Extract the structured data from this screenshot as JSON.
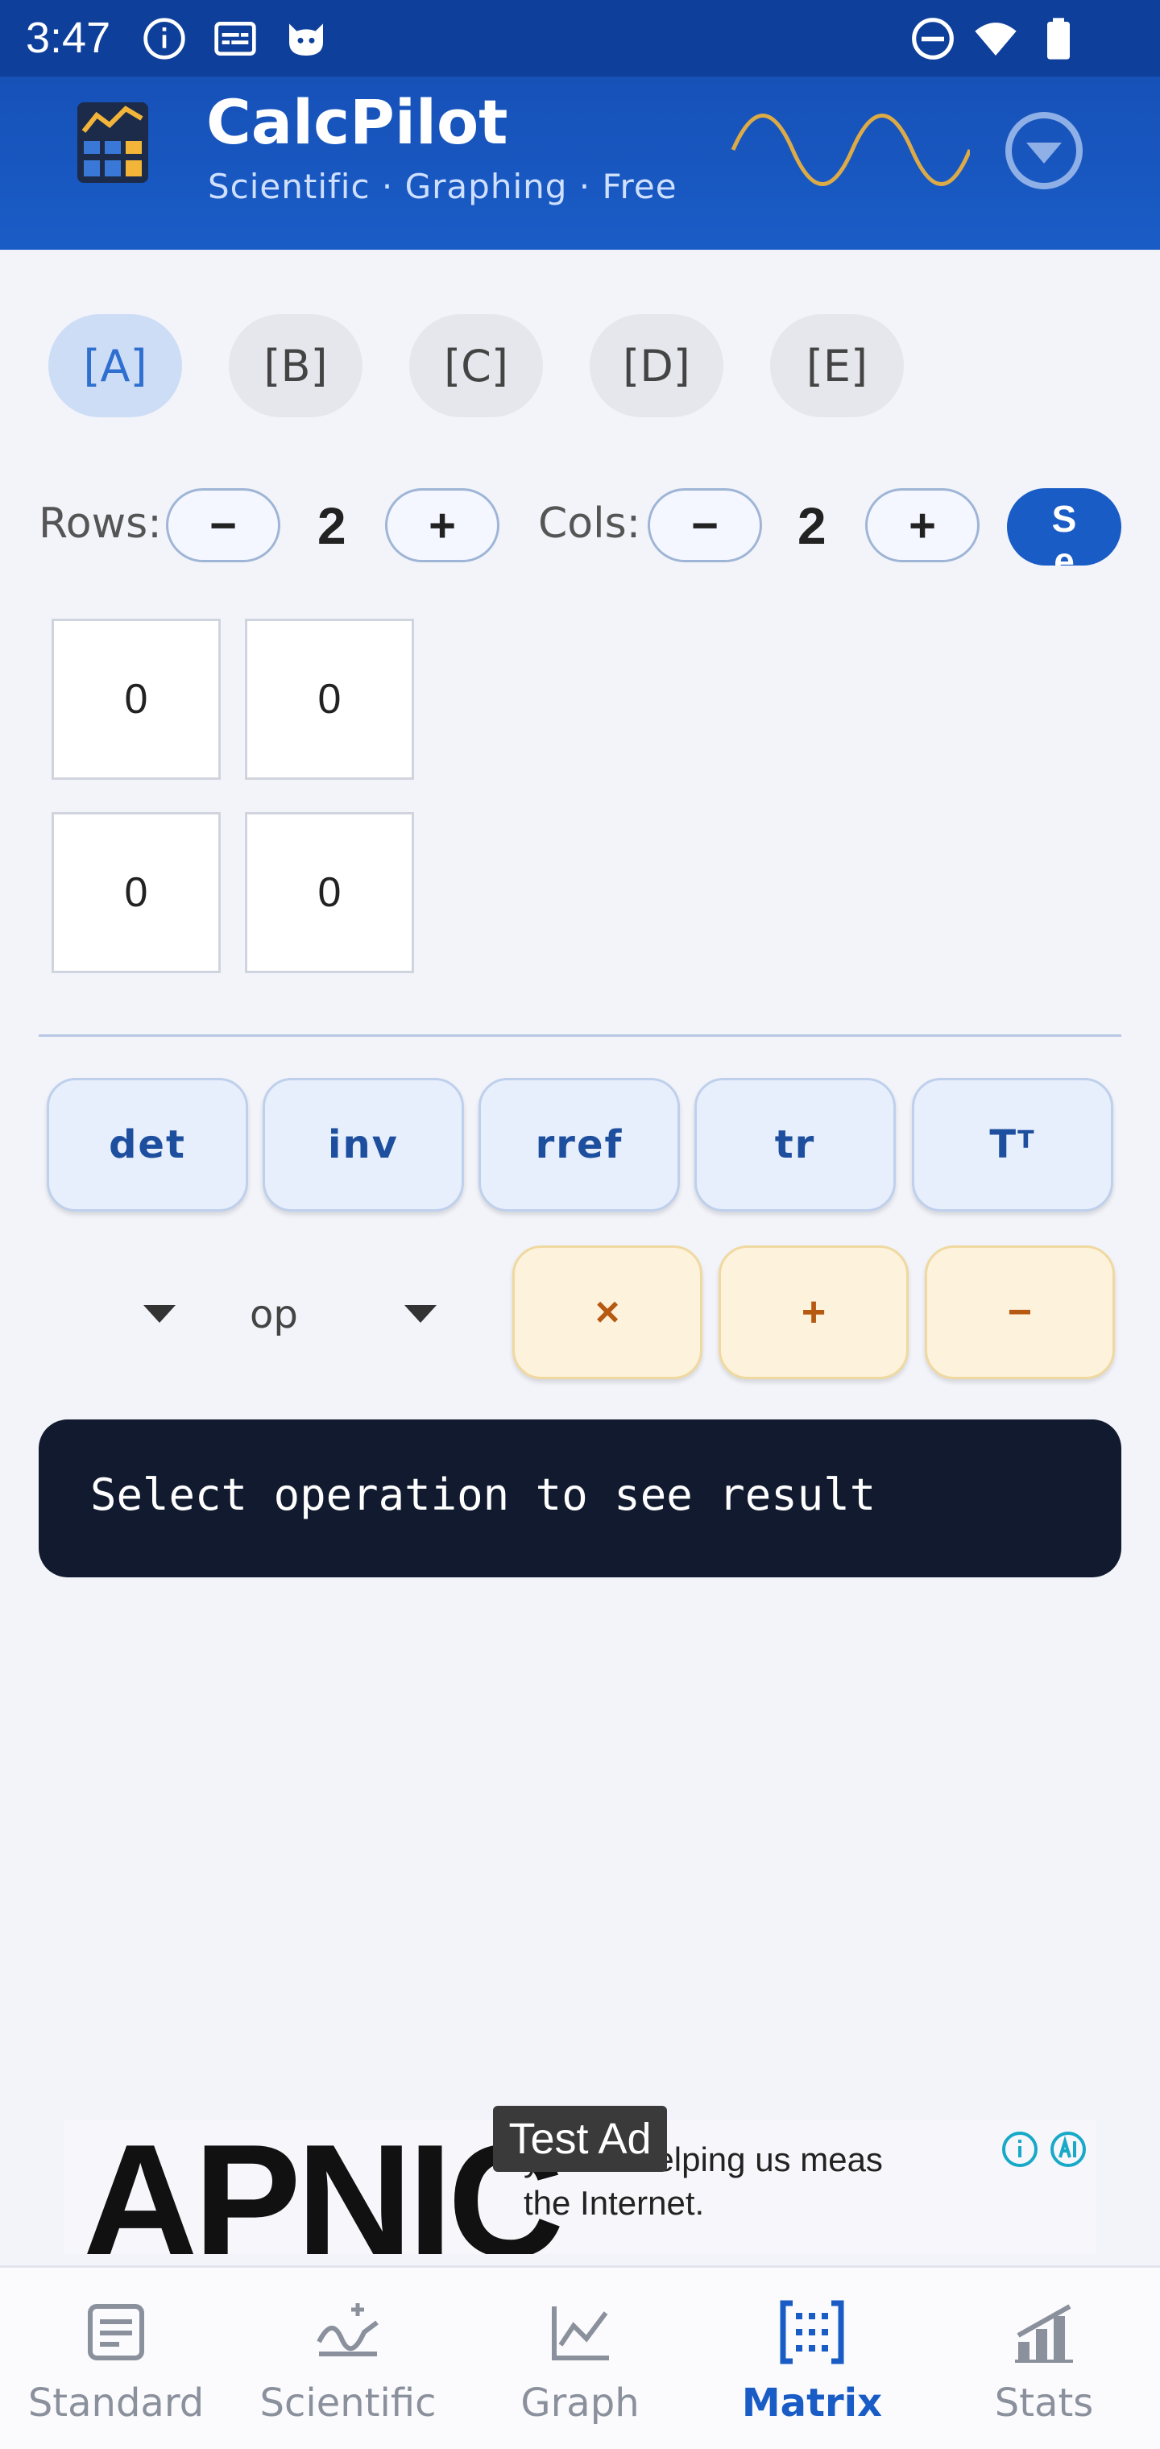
{
  "status_bar": {
    "time": "3:47",
    "left_icons": [
      "info-icon",
      "subtitles-icon",
      "cat-face-icon"
    ],
    "right_icons": [
      "do-not-disturb-icon",
      "wifi-icon",
      "battery-icon"
    ]
  },
  "header": {
    "title": "CalcPilot",
    "subtitle": "Scientific · Graphing · Free",
    "accent": "#1a5cc6",
    "wave_color": "#f2b53a"
  },
  "matrix_tabs": [
    {
      "label": "[A]",
      "active": true
    },
    {
      "label": "[B]",
      "active": false
    },
    {
      "label": "[C]",
      "active": false
    },
    {
      "label": "[D]",
      "active": false
    },
    {
      "label": "[E]",
      "active": false
    }
  ],
  "dimensions": {
    "rows_label": "Rows:",
    "rows_value": "2",
    "cols_label": "Cols:",
    "cols_value": "2",
    "minus_label": "−",
    "plus_label": "+",
    "save_label": "S\ne"
  },
  "matrix_values": [
    [
      "0",
      "0"
    ],
    [
      "0",
      "0"
    ]
  ],
  "unary_ops": [
    {
      "label": "det"
    },
    {
      "label": "inv"
    },
    {
      "label": "rref"
    },
    {
      "label": "tr"
    },
    {
      "label": "T",
      "sup": "T"
    }
  ],
  "binary": {
    "op_label": "op",
    "ops": [
      "×",
      "+",
      "−"
    ]
  },
  "result": {
    "text": "Select operation to see result"
  },
  "ad": {
    "badge": "Test Ad",
    "logo": "APNIC",
    "text": "Thank you for helping us measure the Internet.",
    "visible_text_line1": "you for helping us meas",
    "visible_text_line2": "the Internet."
  },
  "bottom_nav": [
    {
      "label": "Standard",
      "icon": "document-icon",
      "active": false
    },
    {
      "label": "Scientific",
      "icon": "scientific-wave-icon",
      "active": false
    },
    {
      "label": "Graph",
      "icon": "graph-icon",
      "active": false
    },
    {
      "label": "Matrix",
      "icon": "matrix-grid-icon",
      "active": true
    },
    {
      "label": "Stats",
      "icon": "stats-bars-icon",
      "active": false
    }
  ]
}
